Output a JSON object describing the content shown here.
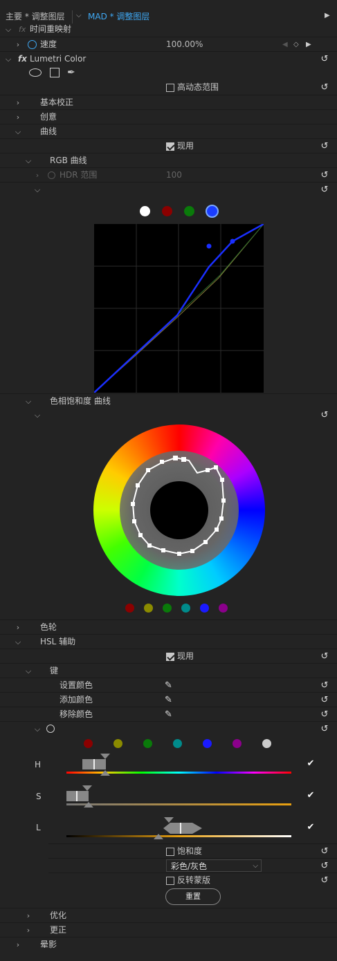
{
  "header": {
    "tab_main": "主要 * 调整图层",
    "tab_active": "MAD * 调整图层"
  },
  "time_remap": {
    "label": "时间重映射"
  },
  "speed": {
    "label": "速度",
    "value": "100.00%"
  },
  "lumetri": {
    "label": "Lumetri Color"
  },
  "hdr": {
    "label": "高动态范围",
    "checked": false
  },
  "sections": {
    "basic": "基本校正",
    "creative": "创意",
    "curves": "曲线",
    "hue_sat_curves": "色相饱和度 曲线",
    "color_wheels": "色轮",
    "hsl": "HSL 辅助",
    "key": "键",
    "refine": "优化",
    "correct": "更正",
    "vignette": "晕影"
  },
  "curves": {
    "enable_label": "现用",
    "enabled": true,
    "rgb_curves": "RGB 曲线",
    "hdr_range_label": "HDR 范围",
    "hdr_range_value": "100",
    "channels": [
      {
        "name": "white",
        "color": "#ffffff",
        "selected": false
      },
      {
        "name": "red",
        "color": "#8b0000",
        "selected": false
      },
      {
        "name": "green",
        "color": "#0a7a0a",
        "selected": false
      },
      {
        "name": "blue",
        "color": "#1a3dff",
        "selected": true
      }
    ]
  },
  "hue_sat": {
    "swatches": [
      "#8b0000",
      "#8b8b00",
      "#0a7a0a",
      "#008b8b",
      "#1a1aff",
      "#8b008b"
    ]
  },
  "hsl": {
    "enable_label": "现用",
    "enabled": true,
    "set_color": "设置颜色",
    "add_color": "添加颜色",
    "remove_color": "移除颜色",
    "presets": [
      "#8b0000",
      "#8b8b00",
      "#0a7a0a",
      "#008b8b",
      "#1a1aff",
      "#8b008b",
      "#cccccc"
    ],
    "h_label": "H",
    "s_label": "S",
    "l_label": "L",
    "saturation_label": "饱和度",
    "saturation_checked": false,
    "mode_value": "彩色/灰色",
    "invert_label": "反转蒙版",
    "invert_checked": false,
    "reset_label": "重置"
  }
}
